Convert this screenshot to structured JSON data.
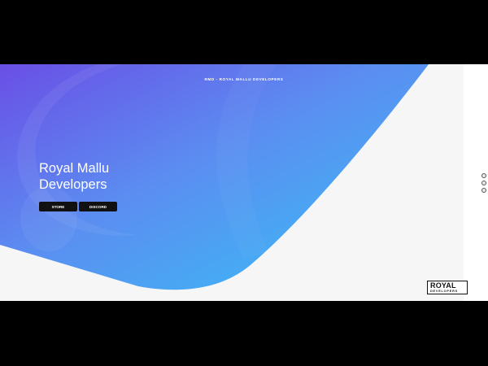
{
  "top_nav": {
    "text": "RMD - ROYAL MALLU DEVELOPERS"
  },
  "hero": {
    "title_line1": "Royal Mallu",
    "title_line2": "Developers",
    "buttons": {
      "store": "STORE",
      "discord": "DISCORD"
    }
  },
  "logo": {
    "main": "ROYAL",
    "sub": "DEVELOPERS"
  },
  "side_icons": [
    "chat-icon",
    "support-icon",
    "circle-icon"
  ],
  "colors": {
    "gradient_start": "#6a4fe6",
    "gradient_mid": "#5b8ef1",
    "gradient_end": "#35c2f6",
    "page_background": "#f6f6f6",
    "button": "#111111"
  }
}
